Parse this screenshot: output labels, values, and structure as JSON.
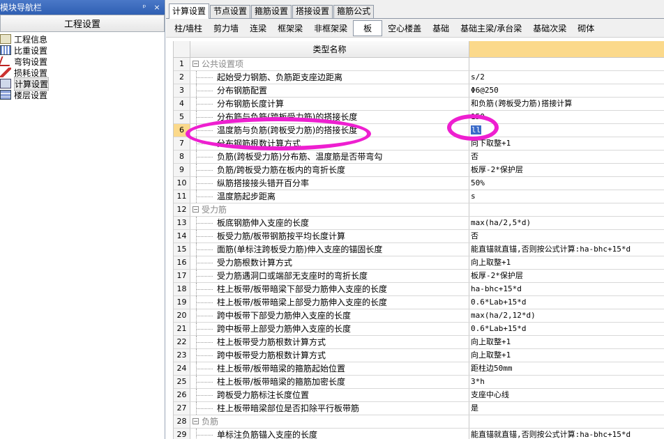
{
  "nav": {
    "title": "模块导航栏",
    "pin": "ᵖ",
    "close": "×",
    "header": "工程设置",
    "items": [
      {
        "label": "工程信息",
        "icon": "doc-icon"
      },
      {
        "label": "比重设置",
        "icon": "grid-icon"
      },
      {
        "label": "弯钩设置",
        "icon": "hook-icon"
      },
      {
        "label": "损耗设置",
        "icon": "pen-icon"
      },
      {
        "label": "计算设置",
        "icon": "calc-icon",
        "selected": true
      },
      {
        "label": "楼层设置",
        "icon": "floor-icon"
      }
    ]
  },
  "tabs": [
    "计算设置",
    "节点设置",
    "箍筋设置",
    "搭接设置",
    "箍筋公式"
  ],
  "subtabs": [
    "柱/墙柱",
    "剪力墙",
    "连梁",
    "框架梁",
    "非框架梁",
    "板",
    "空心楼盖",
    "基础",
    "基础主梁/承台梁",
    "基础次梁",
    "砌体"
  ],
  "grid": {
    "header": "类型名称",
    "rows": [
      {
        "n": "1",
        "name": "公共设置项",
        "value": "",
        "group": true
      },
      {
        "n": "2",
        "name": "起始受力钢筋、负筋距支座边距离",
        "value": "s/2"
      },
      {
        "n": "3",
        "name": "分布钢筋配置",
        "value": "Φ6@250"
      },
      {
        "n": "4",
        "name": "分布钢筋长度计算",
        "value": "和负筋(跨板受力筋)搭接计算"
      },
      {
        "n": "5",
        "name": "分布筋与负筋(跨板受力筋)的搭接长度",
        "value": "150"
      },
      {
        "n": "6",
        "name": "温度筋与负筋(跨板受力筋)的搭接长度",
        "value": "ll",
        "selected": true
      },
      {
        "n": "7",
        "name": "分布钢筋根数计算方式",
        "value": "向下取整+1"
      },
      {
        "n": "8",
        "name": "负筋(跨板受力筋)分布筋、温度筋是否带弯勾",
        "value": "否"
      },
      {
        "n": "9",
        "name": "负筋/跨板受力筋在板内的弯折长度",
        "value": "板厚-2*保护层"
      },
      {
        "n": "10",
        "name": "纵筋搭接接头错开百分率",
        "value": "50%"
      },
      {
        "n": "11",
        "name": "温度筋起步距离",
        "value": "s"
      },
      {
        "n": "12",
        "name": "受力筋",
        "value": "",
        "group": true
      },
      {
        "n": "13",
        "name": "板底钢筋伸入支座的长度",
        "value": "max(ha/2,5*d)"
      },
      {
        "n": "14",
        "name": "板受力筋/板带钢筋按平均长度计算",
        "value": "否"
      },
      {
        "n": "15",
        "name": "面筋(单标注跨板受力筋)伸入支座的锚固长度",
        "value": "能直锚就直锚,否则按公式计算:ha-bhc+15*d"
      },
      {
        "n": "16",
        "name": "受力筋根数计算方式",
        "value": "向上取整+1"
      },
      {
        "n": "17",
        "name": "受力筋遇洞口或端部无支座时的弯折长度",
        "value": "板厚-2*保护层"
      },
      {
        "n": "18",
        "name": "柱上板带/板带暗梁下部受力筋伸入支座的长度",
        "value": "ha-bhc+15*d"
      },
      {
        "n": "19",
        "name": "柱上板带/板带暗梁上部受力筋伸入支座的长度",
        "value": "0.6*Lab+15*d"
      },
      {
        "n": "20",
        "name": "跨中板带下部受力筋伸入支座的长度",
        "value": "max(ha/2,12*d)"
      },
      {
        "n": "21",
        "name": "跨中板带上部受力筋伸入支座的长度",
        "value": "0.6*Lab+15*d"
      },
      {
        "n": "22",
        "name": "柱上板带受力筋根数计算方式",
        "value": "向上取整+1"
      },
      {
        "n": "23",
        "name": "跨中板带受力筋根数计算方式",
        "value": "向上取整+1"
      },
      {
        "n": "24",
        "name": "柱上板带/板带暗梁的箍筋起始位置",
        "value": "距柱边50mm"
      },
      {
        "n": "25",
        "name": "柱上板带/板带暗梁的箍筋加密长度",
        "value": "3*h"
      },
      {
        "n": "26",
        "name": "跨板受力筋标注长度位置",
        "value": "支座中心线"
      },
      {
        "n": "27",
        "name": "柱上板带暗梁部位是否扣除平行板带筋",
        "value": "是"
      },
      {
        "n": "28",
        "name": "负筋",
        "value": "",
        "group": true
      },
      {
        "n": "29",
        "name": "单标注负筋锚入支座的长度",
        "value": "能直锚就直锚,否则按公式计算:ha-bhc+15*d"
      }
    ]
  },
  "colors": {
    "highlight": "#ee1fd0",
    "header_accent": "#fbd98b",
    "nav_title_bg": "#2f5fb3"
  }
}
